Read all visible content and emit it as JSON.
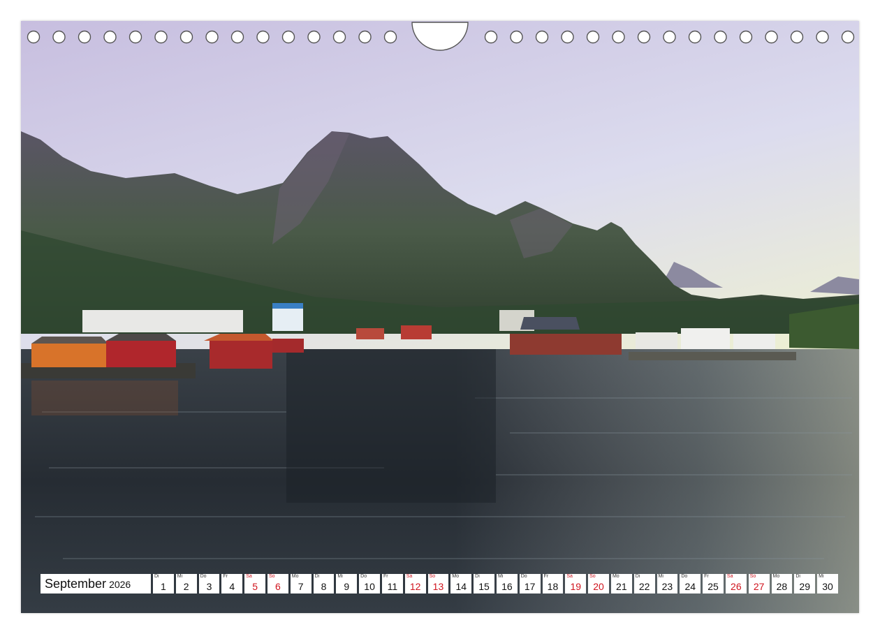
{
  "calendar": {
    "month": "September",
    "year": "2026",
    "days": [
      {
        "wd": "Di",
        "n": "1",
        "we": false
      },
      {
        "wd": "Mi",
        "n": "2",
        "we": false
      },
      {
        "wd": "Do",
        "n": "3",
        "we": false
      },
      {
        "wd": "Fr",
        "n": "4",
        "we": false
      },
      {
        "wd": "Sa",
        "n": "5",
        "we": true
      },
      {
        "wd": "So",
        "n": "6",
        "we": true
      },
      {
        "wd": "Mo",
        "n": "7",
        "we": false
      },
      {
        "wd": "Di",
        "n": "8",
        "we": false
      },
      {
        "wd": "Mi",
        "n": "9",
        "we": false
      },
      {
        "wd": "Do",
        "n": "10",
        "we": false
      },
      {
        "wd": "Fr",
        "n": "11",
        "we": false
      },
      {
        "wd": "Sa",
        "n": "12",
        "we": true
      },
      {
        "wd": "So",
        "n": "13",
        "we": true
      },
      {
        "wd": "Mo",
        "n": "14",
        "we": false
      },
      {
        "wd": "Di",
        "n": "15",
        "we": false
      },
      {
        "wd": "Mi",
        "n": "16",
        "we": false
      },
      {
        "wd": "Do",
        "n": "17",
        "we": false
      },
      {
        "wd": "Fr",
        "n": "18",
        "we": false
      },
      {
        "wd": "Sa",
        "n": "19",
        "we": true
      },
      {
        "wd": "So",
        "n": "20",
        "we": true
      },
      {
        "wd": "Mo",
        "n": "21",
        "we": false
      },
      {
        "wd": "Di",
        "n": "22",
        "we": false
      },
      {
        "wd": "Mi",
        "n": "23",
        "we": false
      },
      {
        "wd": "Do",
        "n": "24",
        "we": false
      },
      {
        "wd": "Fr",
        "n": "25",
        "we": false
      },
      {
        "wd": "Sa",
        "n": "26",
        "we": true
      },
      {
        "wd": "So",
        "n": "27",
        "we": true
      },
      {
        "wd": "Mo",
        "n": "28",
        "we": false
      },
      {
        "wd": "Di",
        "n": "29",
        "we": false
      },
      {
        "wd": "Mi",
        "n": "30",
        "we": false
      }
    ]
  },
  "colors": {
    "weekend": "#d0141e",
    "sky_top": "#c8bfe0",
    "sky_horizon": "#f6ec9c",
    "water": "#2a3038"
  }
}
